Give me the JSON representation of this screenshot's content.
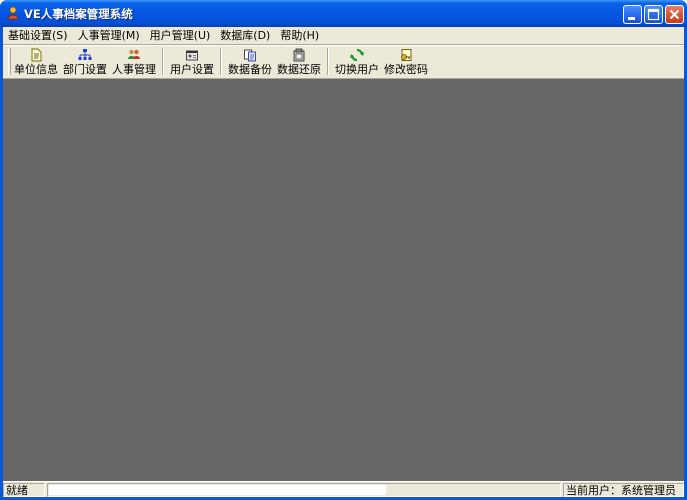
{
  "window": {
    "title": "VE人事档案管理系统",
    "app_icon": "person-icon",
    "controls": [
      "minimize-icon",
      "maximize-icon",
      "close-icon"
    ]
  },
  "menubar": {
    "items": [
      {
        "label": "基础设置(S)"
      },
      {
        "label": "人事管理(M)"
      },
      {
        "label": "用户管理(U)"
      },
      {
        "label": "数据库(D)"
      },
      {
        "label": "帮助(H)"
      }
    ]
  },
  "toolbar": {
    "groups": [
      [
        {
          "label": "单位信息",
          "icon": "document-icon"
        },
        {
          "label": "部门设置",
          "icon": "org-chart-icon"
        },
        {
          "label": "人事管理",
          "icon": "people-icon"
        }
      ],
      [
        {
          "label": "用户设置",
          "icon": "user-settings-icon"
        }
      ],
      [
        {
          "label": "数据备份",
          "icon": "backup-icon"
        },
        {
          "label": "数据还原",
          "icon": "restore-icon"
        }
      ],
      [
        {
          "label": "切换用户",
          "icon": "switch-user-icon"
        },
        {
          "label": "修改密码",
          "icon": "password-icon"
        }
      ]
    ]
  },
  "workspace": {
    "background": "#666666"
  },
  "statusbar": {
    "status": "就绪",
    "progress": 0.66,
    "current_user": "当前用户：系统管理员"
  }
}
